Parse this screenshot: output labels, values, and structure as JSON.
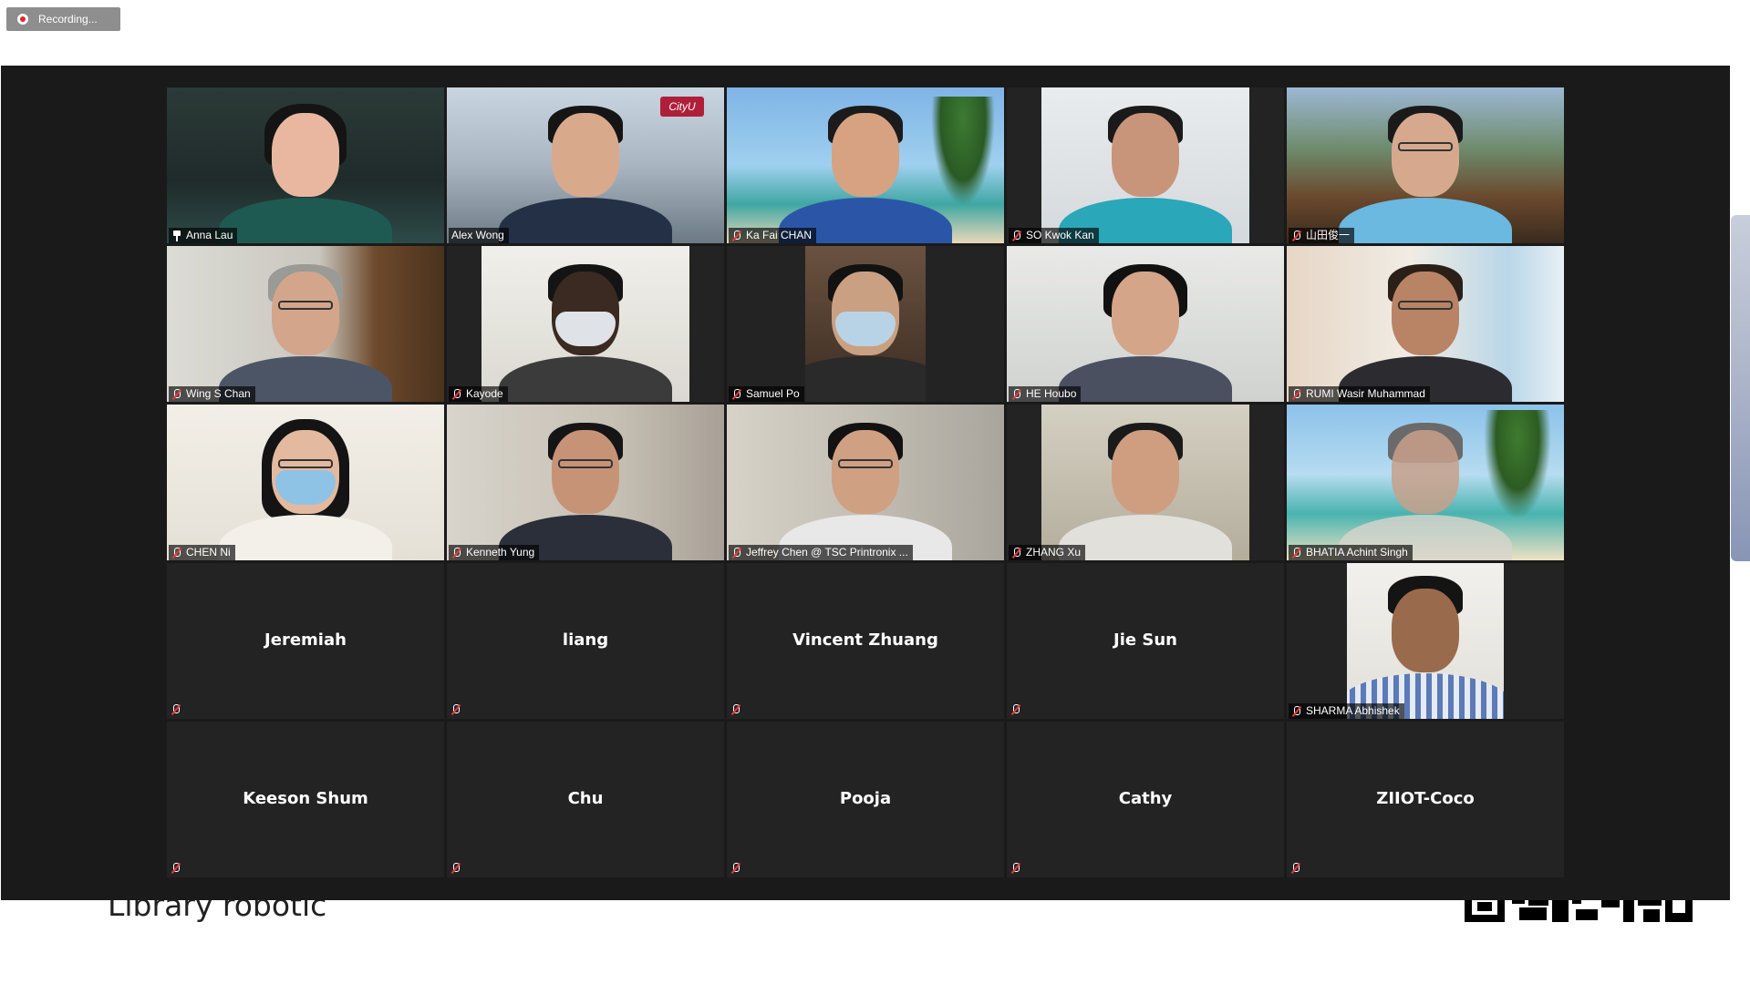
{
  "recording": {
    "label": "Recording..."
  },
  "slide": {
    "text": "Library robotic"
  },
  "colors": {
    "panel": "#1a1a1a",
    "tile": "#232323",
    "active_border": "#c7d32f",
    "muted": "#e33b3b"
  },
  "video_tiles": [
    {
      "name": "Anna Lau",
      "icon": "pin-icon",
      "muted": false,
      "active": true
    },
    {
      "name": "Alex Wong",
      "icon": "none",
      "muted": false,
      "active": false,
      "logo": "CityU"
    },
    {
      "name": "Ka Fai CHAN",
      "icon": "mic-muted-icon",
      "muted": true
    },
    {
      "name": "SO Kwok Kan",
      "icon": "mic-muted-icon",
      "muted": true
    },
    {
      "name": "山田俊一",
      "icon": "mic-muted-icon",
      "muted": true
    },
    {
      "name": "Wing S Chan",
      "icon": "mic-muted-icon",
      "muted": true
    },
    {
      "name": "Kayode",
      "icon": "mic-muted-icon",
      "muted": true
    },
    {
      "name": "Samuel Po",
      "icon": "mic-muted-icon",
      "muted": true
    },
    {
      "name": "HE Houbo",
      "icon": "mic-muted-icon",
      "muted": true
    },
    {
      "name": "RUMI Wasir Muhammad",
      "icon": "mic-muted-icon",
      "muted": true
    },
    {
      "name": "CHEN Ni",
      "icon": "mic-muted-icon",
      "muted": true
    },
    {
      "name": "Kenneth Yung",
      "icon": "mic-muted-icon",
      "muted": true
    },
    {
      "name": "Jeffrey Chen @ TSC Printronix ...",
      "icon": "mic-muted-icon",
      "muted": true
    },
    {
      "name": "ZHANG Xu",
      "icon": "mic-muted-icon",
      "muted": true
    },
    {
      "name": "BHATIA Achint Singh",
      "icon": "mic-muted-icon",
      "muted": true
    }
  ],
  "row4": [
    {
      "name": "Jeremiah",
      "muted": true
    },
    {
      "name": "liang",
      "muted": true
    },
    {
      "name": "Vincent Zhuang",
      "muted": true
    },
    {
      "name": "Jie Sun",
      "muted": true
    },
    {
      "name": "SHARMA Abhishek",
      "muted": true,
      "video": true
    }
  ],
  "row5": [
    {
      "name": "Keeson Shum",
      "muted": true
    },
    {
      "name": "Chu",
      "muted": true
    },
    {
      "name": "Pooja",
      "muted": true
    },
    {
      "name": "Cathy",
      "muted": true
    },
    {
      "name": "ZIIOT-Coco",
      "muted": true
    }
  ]
}
